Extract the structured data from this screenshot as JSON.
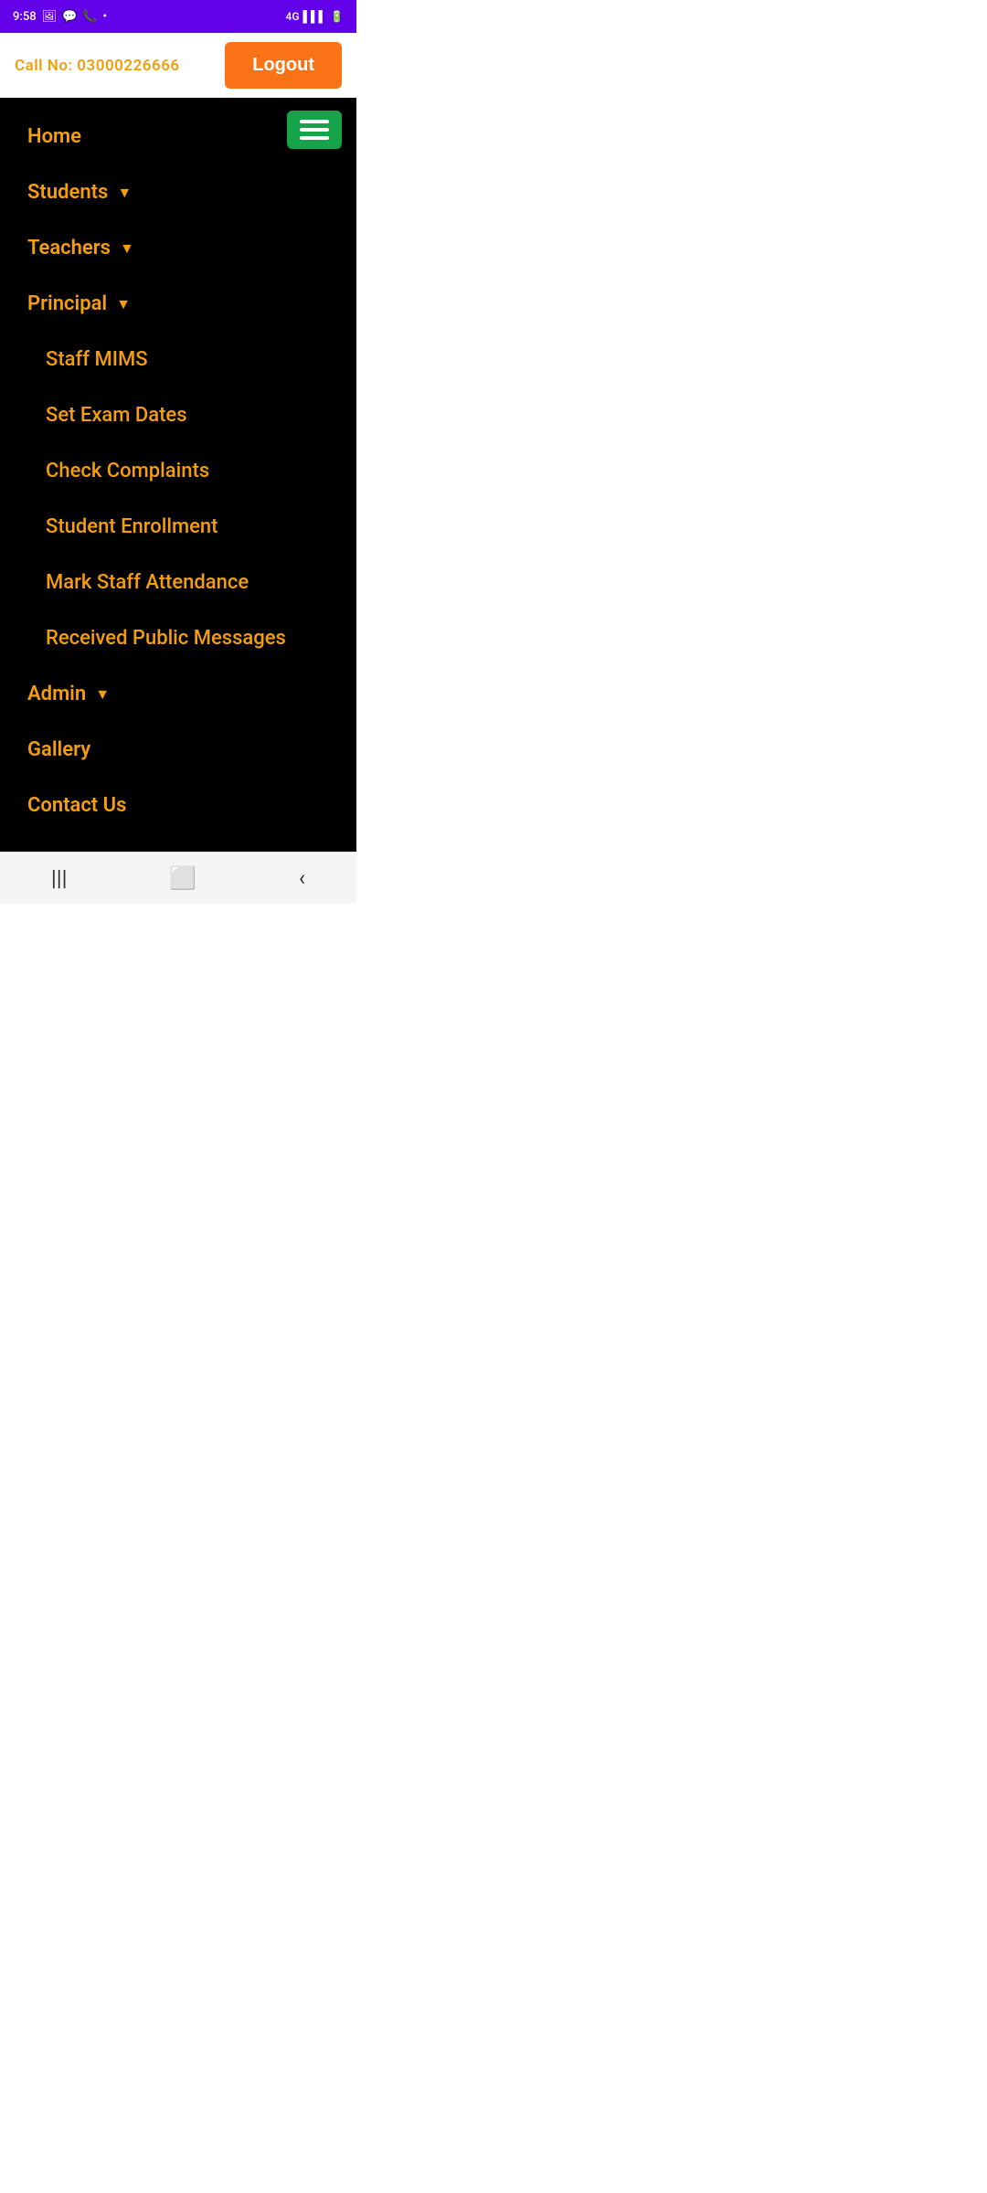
{
  "statusBar": {
    "time": "9:58",
    "network": "4G",
    "battery": "🔋"
  },
  "header": {
    "callNo": "Call No: 03000226666",
    "logoutLabel": "Logout"
  },
  "nav": {
    "hamburgerAriaLabel": "Menu",
    "items": [
      {
        "id": "home",
        "label": "Home",
        "hasDropdown": false,
        "subItems": []
      },
      {
        "id": "students",
        "label": "Students",
        "hasDropdown": true,
        "subItems": []
      },
      {
        "id": "teachers",
        "label": "Teachers",
        "hasDropdown": true,
        "subItems": []
      },
      {
        "id": "principal",
        "label": "Principal",
        "hasDropdown": true,
        "subItems": [
          {
            "id": "staff-mims",
            "label": "Staff MIMS"
          },
          {
            "id": "set-exam-dates",
            "label": "Set Exam Dates"
          },
          {
            "id": "check-complaints",
            "label": "Check Complaints"
          },
          {
            "id": "student-enrollment",
            "label": "Student  Enrollment"
          },
          {
            "id": "mark-staff-attendance",
            "label": "Mark Staff Attendance"
          },
          {
            "id": "received-public-messages",
            "label": "Received Public Messages"
          }
        ]
      },
      {
        "id": "admin",
        "label": "Admin",
        "hasDropdown": true,
        "subItems": []
      },
      {
        "id": "gallery",
        "label": "Gallery",
        "hasDropdown": false,
        "subItems": []
      },
      {
        "id": "contact-us",
        "label": "Contact Us",
        "hasDropdown": false,
        "subItems": []
      }
    ]
  },
  "bottomNav": {
    "recentApps": "|||",
    "home": "⬜",
    "back": "‹"
  }
}
